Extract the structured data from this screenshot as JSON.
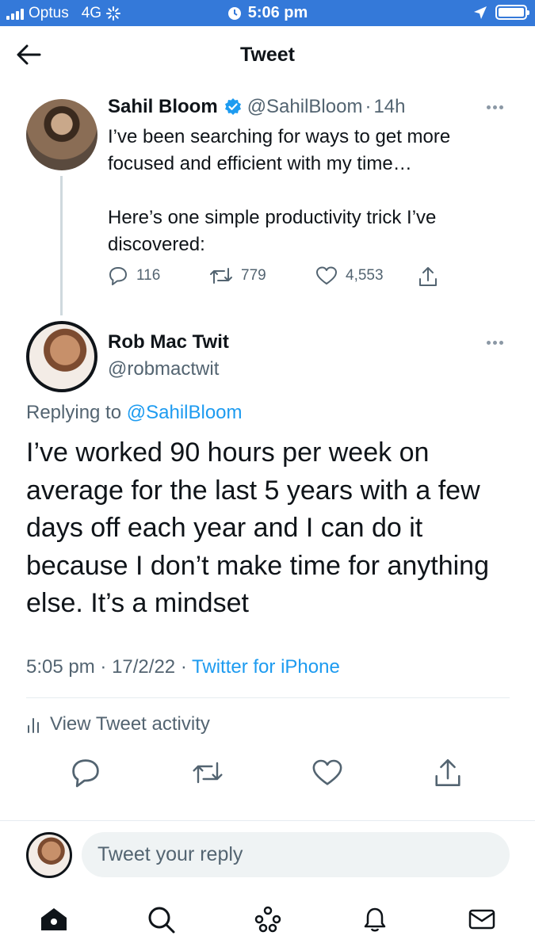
{
  "status_bar": {
    "carrier": "Optus",
    "network": "4G",
    "time": "5:06 pm",
    "icons": [
      "signal-bars-icon",
      "activity-spinner-icon",
      "alarm-icon",
      "location-icon",
      "battery-icon"
    ]
  },
  "header": {
    "title": "Tweet",
    "back_icon": "arrow-left-icon"
  },
  "parent_tweet": {
    "name": "Sahil Bloom",
    "verified": true,
    "handle": "@SahilBloom",
    "separator": "·",
    "age": "14h",
    "text_line_1": "I’ve been searching for ways to get more focused and efficient with my time…",
    "text_line_2": "Here’s one simple productivity trick I’ve discovered:",
    "replies": "116",
    "retweets": "779",
    "likes": "4,553"
  },
  "main_tweet": {
    "name": "Rob Mac Twit",
    "handle": "@robmactwit",
    "replying_prefix": "Replying to",
    "replying_to": "@SahilBloom",
    "text": "I’ve worked 90 hours per week on average for the last 5 years with a few days off each year and I can do it because I don’t make time for anything else. It’s a mindset",
    "time": "5:05 pm",
    "sep1": "·",
    "date": "17/2/22",
    "sep2": "·",
    "source": "Twitter for iPhone",
    "activity_label": "View Tweet activity"
  },
  "reply_bar": {
    "placeholder": "Tweet your reply"
  },
  "bottom_nav": {
    "items": [
      "home-icon",
      "search-icon",
      "spaces-icon",
      "notifications-icon",
      "messages-icon"
    ]
  },
  "colors": {
    "status_bar": "#3479d9",
    "link": "#1d9bf0",
    "secondary_text": "#536471",
    "verified": "#1d9bf0"
  }
}
